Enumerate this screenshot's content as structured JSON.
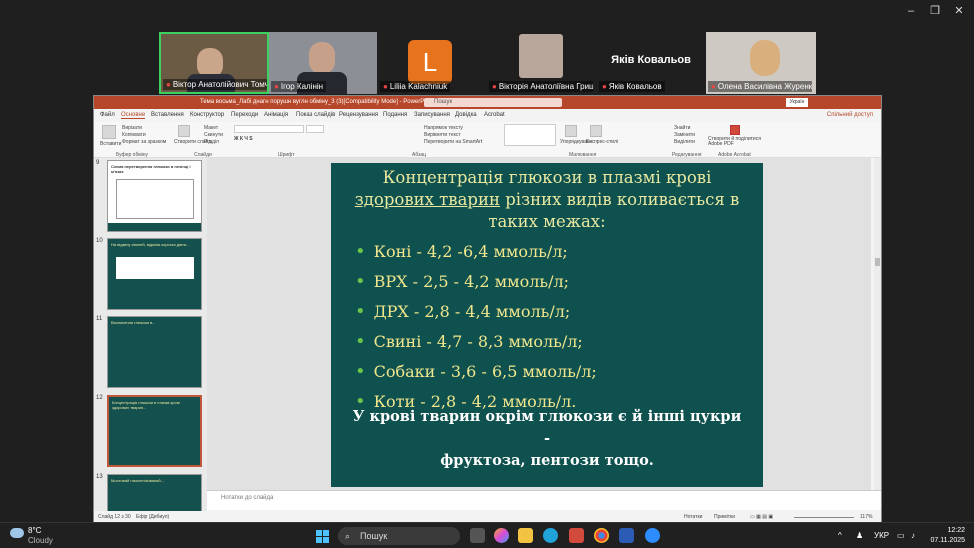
{
  "zoom": {
    "window_controls": [
      "–",
      "❐",
      "✕"
    ]
  },
  "participants": [
    {
      "name": "Віктор Анатолійович Томчук",
      "muted": true
    },
    {
      "name": "Ігор Калінін",
      "muted": true
    },
    {
      "name": "Liliia Kalachniuk",
      "initial": "L",
      "muted": true
    },
    {
      "name": "Вікторія Анатоліївна Грище...",
      "muted": true
    },
    {
      "name": "Яків Ковальов",
      "muted": true,
      "display_name": "Яків Ковальов"
    },
    {
      "name": "Олена Василівна Журенко",
      "muted": true
    }
  ],
  "powerpoint": {
    "title": "Тема восьма_Лабі днагн порушн вуглн обміну_3 (3)[Compatibility Mode] - PowerPoint",
    "search_placeholder": "Пошук",
    "user": "Україн",
    "share": "Спільний доступ",
    "tabs": [
      "Файл",
      "Основне",
      "Вставлення",
      "Конструктор",
      "Переходи",
      "Анімація",
      "Показ слайдів",
      "Рецензування",
      "Подання",
      "Записування",
      "Довідка",
      "Acrobat"
    ],
    "active_tab": "Основне",
    "ribbon_groups": [
      "Буфер обміну",
      "Слайди",
      "Шрифт",
      "Абзац",
      "Малювання",
      "Редагування",
      "Adobe Acrobat"
    ],
    "ribbon_labels": {
      "paste": "Вставити",
      "cut": "Вирізати",
      "copy": "Копіювати",
      "format_painter": "Формат за зразком",
      "new_slide": "Створити слайд",
      "layout": "Макет",
      "reset": "Скинути",
      "section": "Розділ",
      "arrange": "Упорядкувати",
      "quick_styles": "Експрес-стилі",
      "find": "Знайти",
      "replace": "Замінити",
      "select": "Виділити",
      "adobe_pdf": "Створити й поділитися Adobe PDF",
      "text_direction": "Напрямок тексту",
      "align_text": "Вирівняти текст",
      "smartart": "Перетворити на SmartArt"
    },
    "notes_placeholder": "Нотатки до слайда",
    "status": {
      "slide": "Слайд 12 з 30",
      "language": "Ефір (Дибиул)",
      "notes": "Нотатки",
      "comments": "Примітки",
      "zoom": "117%"
    }
  },
  "thumbnails": [
    {
      "num": "9",
      "text": "Схема перетворення глюкози в печінці і м'язах"
    },
    {
      "num": "10",
      "text": "На відміну свиней, відміна коротка діяти..."
    },
    {
      "num": "11",
      "text": "Визначення глюкози в..."
    },
    {
      "num": "12",
      "text": "Концентрація глюкози в плазмі крові здорових тварин..."
    },
    {
      "num": "13",
      "text": "Мостовий гомогенізований…"
    }
  ],
  "slide": {
    "title_line1": "Концентрація глюкози в плазмі крові",
    "title_underlined": "здорових тварин",
    "title_rest": " різних видів коливається в",
    "title_line3": "таких межах:",
    "bullets": [
      "Коні - 4,2 -6,4 ммоль/л;",
      "ВРХ - 2,5 - 4,2 ммоль/л;",
      "ДРХ - 2,8 - 4,4 ммоль/л;",
      "Свині - 4,7 - 8,3 ммоль/л;",
      "Собаки - 3,6 - 6,5 ммоль/л;",
      "Коти - 2,8 - 4,2 ммоль/л."
    ],
    "note_line1": "У крові тварин окрім глюкози є й інші цукри -",
    "note_line2": "фруктоза, пентози тощо."
  },
  "taskbar": {
    "temperature": "8°C",
    "weather": "Cloudy",
    "search": "Пошук",
    "language": "УКР",
    "time": "12:22",
    "date": "07.11.2025"
  }
}
